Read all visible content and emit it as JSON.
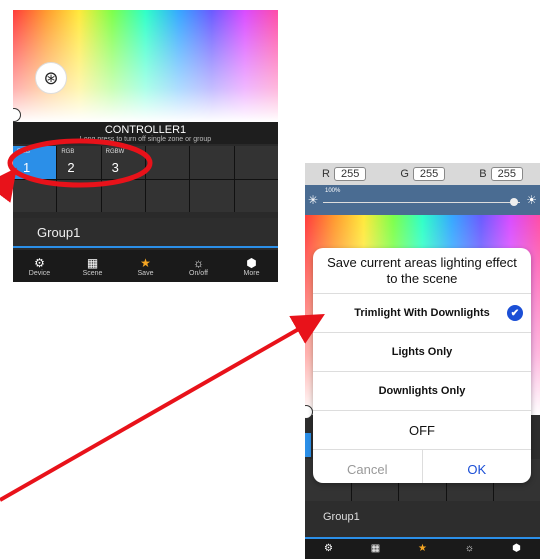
{
  "left_screen": {
    "controller_title": "CONTROLLER1",
    "controller_subtitle": "Long press to turn off single zone or group",
    "zones": [
      {
        "type": "RGB",
        "number": "1",
        "active": true
      },
      {
        "type": "RGB",
        "number": "2",
        "active": false
      },
      {
        "type": "RGBW",
        "number": "3",
        "active": false
      }
    ],
    "group_label": "Group1",
    "nav": [
      {
        "icon": "gear-icon",
        "label": "Device"
      },
      {
        "icon": "grid-icon",
        "label": "Scene"
      },
      {
        "icon": "star-icon",
        "label": "Save"
      },
      {
        "icon": "bulb-icon",
        "label": "On/off"
      },
      {
        "icon": "cube-icon",
        "label": "More"
      }
    ]
  },
  "right_screen": {
    "rgb": {
      "r_label": "R",
      "r_value": "255",
      "g_label": "G",
      "g_value": "255",
      "b_label": "B",
      "b_value": "255"
    },
    "brightness_label": "100%",
    "brightness": 1.0,
    "group_label": "Group1",
    "dialog": {
      "title": "Save current areas lighting effect to the scene",
      "options": [
        {
          "label": "Trimlight With Downlights",
          "selected": true
        },
        {
          "label": "Lights Only",
          "selected": false
        },
        {
          "label": "Downlights Only",
          "selected": false
        },
        {
          "label": "OFF",
          "selected": false
        }
      ],
      "cancel_label": "Cancel",
      "ok_label": "OK"
    }
  },
  "colors": {
    "accent": "#2b8fe8",
    "annotation": "#e8121a",
    "save_star": "#f5a623",
    "ok": "#1b4fd6"
  }
}
